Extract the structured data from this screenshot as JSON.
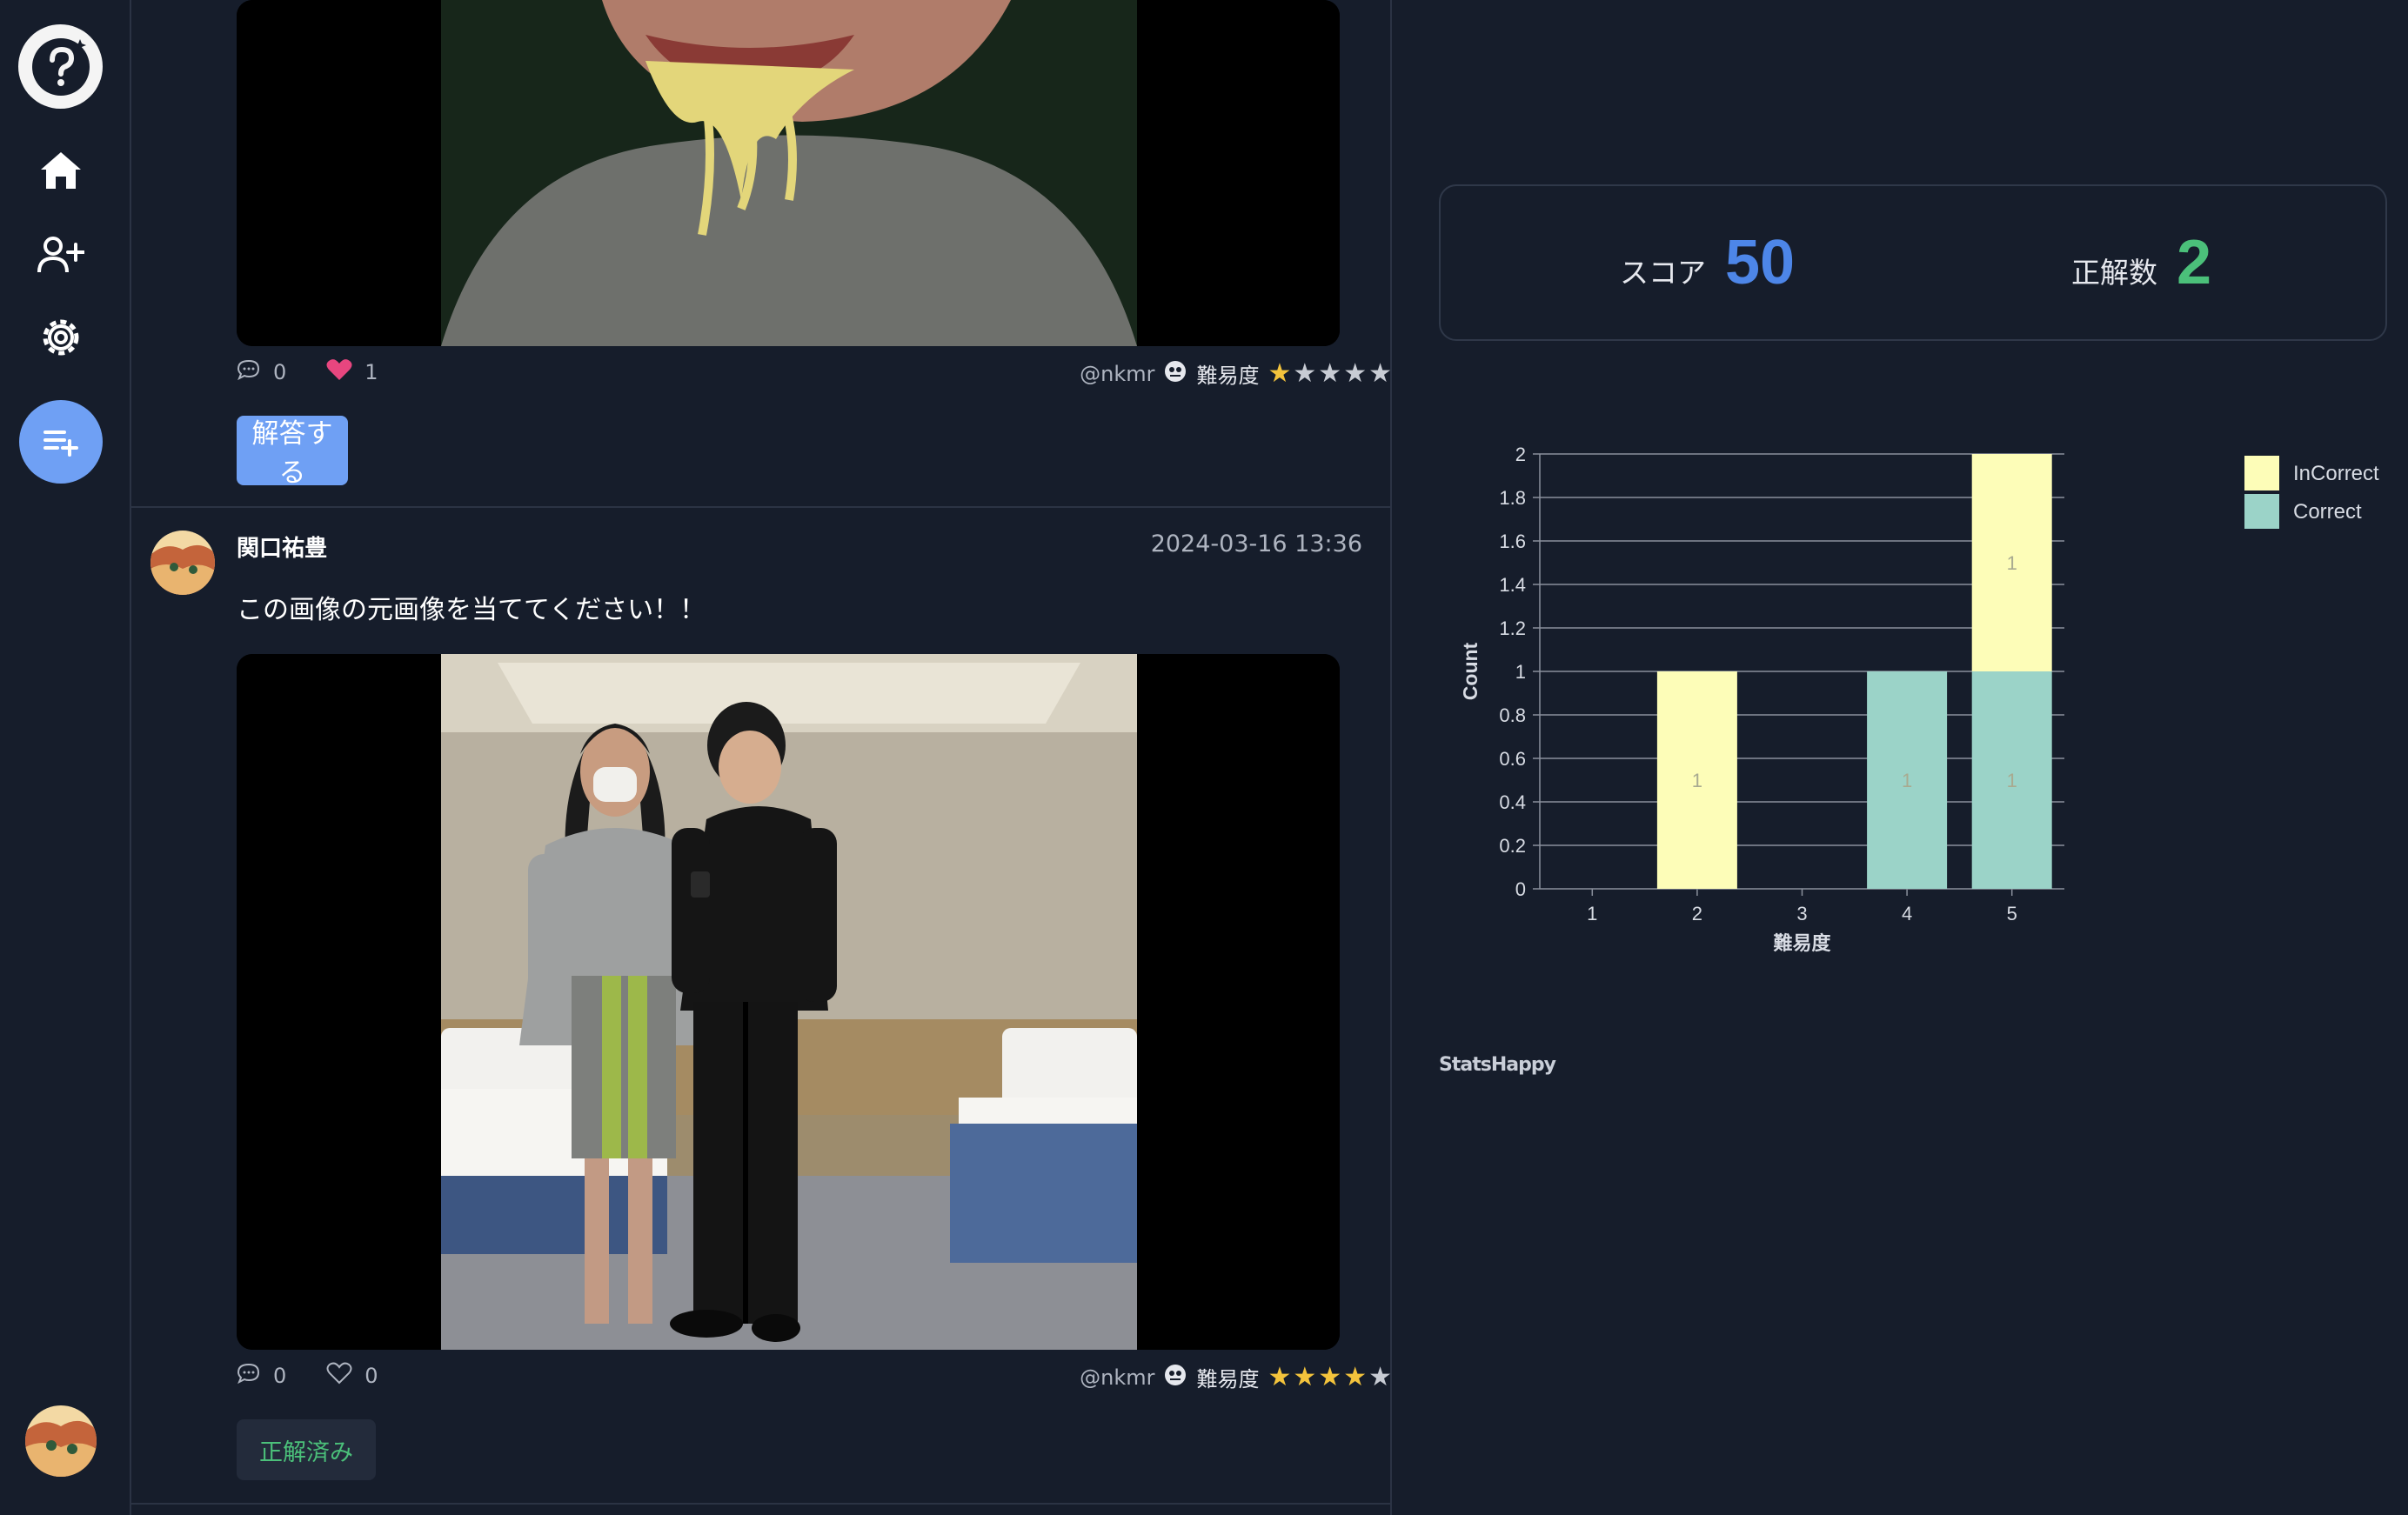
{
  "sidebar": {
    "items": [
      {
        "icon": "home-icon"
      },
      {
        "icon": "add-user-icon"
      },
      {
        "icon": "gear-icon"
      }
    ],
    "fab_icon": "playlist-add-icon"
  },
  "posts": [
    {
      "comments": "0",
      "likes": "1",
      "liked": true,
      "author_handle": "@nkmr",
      "difficulty_label": "難易度",
      "difficulty": 1,
      "action_label": "解答する"
    },
    {
      "author_name": "関口祐豊",
      "timestamp": "2024-03-16 13:36",
      "text": "この画像の元画像を当ててください！！",
      "comments": "0",
      "likes": "0",
      "liked": false,
      "author_handle": "@nkmr",
      "difficulty_label": "難易度",
      "difficulty": 4,
      "action_label": "正解済み"
    }
  ],
  "score": {
    "score_label": "スコア",
    "score_value": "50",
    "correct_label": "正解数",
    "correct_value": "2",
    "score_color": "#4d86e8",
    "correct_color": "#4bc07a"
  },
  "chart_data": {
    "type": "bar",
    "stacked": true,
    "categories": [
      "1",
      "2",
      "3",
      "4",
      "5"
    ],
    "series": [
      {
        "name": "Correct",
        "values": [
          0,
          0,
          0,
          1,
          1
        ],
        "color": "#9bd3c8"
      },
      {
        "name": "InCorrect",
        "values": [
          0,
          1,
          0,
          0,
          1
        ],
        "color": "#fdfdb8"
      }
    ],
    "xlabel": "難易度",
    "ylabel": "Count",
    "ylim": [
      0,
      2
    ],
    "yticks": [
      "0",
      "0.2",
      "0.4",
      "0.6",
      "0.8",
      "1",
      "1.2",
      "1.4",
      "1.6",
      "1.8",
      "2"
    ],
    "legend_position": "top-right",
    "grid": true
  },
  "stats_label": "StatsHappy"
}
